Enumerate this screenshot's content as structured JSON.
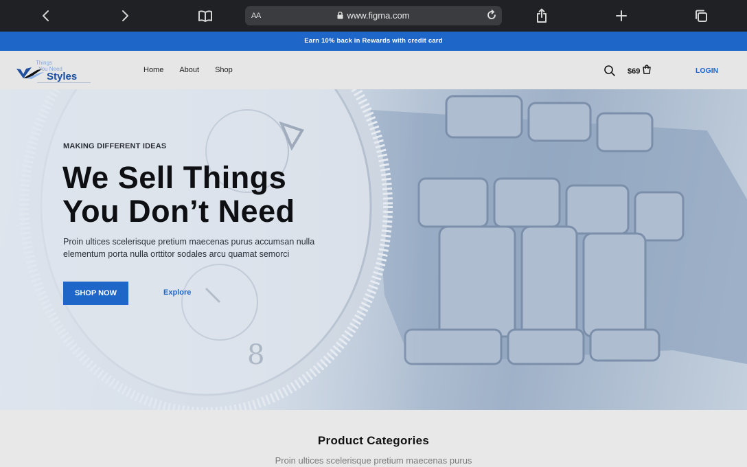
{
  "browser": {
    "url": "www.figma.com",
    "aa_label": "AA"
  },
  "promo": {
    "text": "Earn 10% back in Rewards with credit card"
  },
  "header": {
    "logo_tagline": "Things\nYou Need",
    "logo_word": "Styles",
    "nav": [
      "Home",
      "About",
      "Shop"
    ],
    "cart_price": "$69",
    "login_label": "LOGIN"
  },
  "hero": {
    "eyebrow": "MAKING DIFFERENT IDEAS",
    "headline_line1": "We Sell Things",
    "headline_line2": "You Don’t Need",
    "subtext": "Proin ultices scelerisque pretium maecenas purus accumsan nulla elementum porta nulla orttitor sodales arcu quamat semorci",
    "shop_label": "SHOP NOW",
    "explore_label": "Explore"
  },
  "categories": {
    "title": "Product Categories",
    "subtitle": "Proin ultices scelerisque pretium maecenas purus"
  },
  "colors": {
    "accent": "#1f66c9",
    "toolbar": "#1f2124"
  },
  "icons": [
    "back-icon",
    "forward-icon",
    "bookmarks-icon",
    "lock-icon",
    "reload-icon",
    "share-icon",
    "new-tab-icon",
    "tabs-icon",
    "search-icon",
    "cart-icon"
  ]
}
